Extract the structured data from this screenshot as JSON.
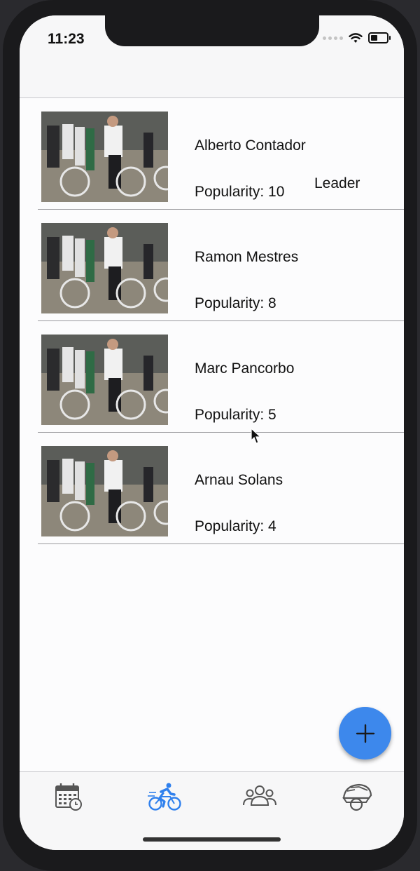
{
  "status_bar": {
    "time": "11:23"
  },
  "riders": [
    {
      "name": "Alberto Contador",
      "popularity": "Popularity: 10",
      "badge": "Leader"
    },
    {
      "name": "Ramon Mestres",
      "popularity": "Popularity: 8",
      "badge": ""
    },
    {
      "name": "Marc Pancorbo",
      "popularity": "Popularity: 5",
      "badge": ""
    },
    {
      "name": "Arnau Solans",
      "popularity": "Popularity: 4",
      "badge": ""
    }
  ],
  "tabs": [
    {
      "icon": "calendar-icon",
      "active": false
    },
    {
      "icon": "cyclist-icon",
      "active": true
    },
    {
      "icon": "group-icon",
      "active": false
    },
    {
      "icon": "helmet-icon",
      "active": false
    }
  ],
  "colors": {
    "accent": "#3d88ec",
    "active_tab": "#2f80ed",
    "inactive_tab": "#555555"
  }
}
